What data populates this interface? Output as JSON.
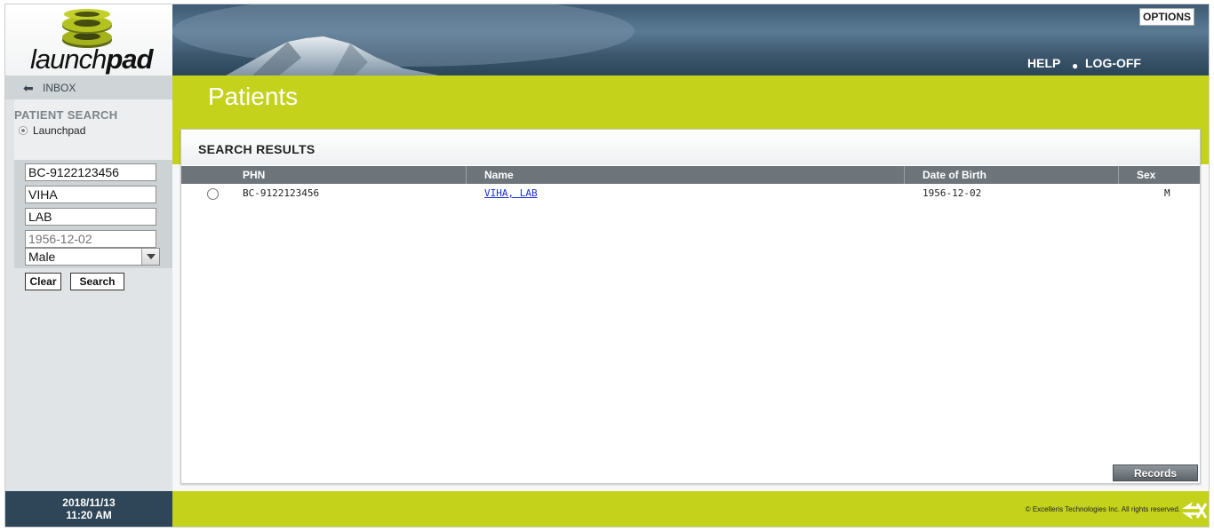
{
  "app": {
    "logo_text_regular": "launch",
    "logo_text_bold": "pad"
  },
  "header": {
    "options_label": "OPTIONS",
    "help_label": "HELP",
    "logoff_label": "LOG-OFF",
    "separator": "●"
  },
  "sidebar": {
    "inbox_label": "INBOX",
    "patient_search_title": "PATIENT SEARCH",
    "source_option": "Launchpad",
    "phn_value": "BC-9122123456",
    "last_name_value": "VIHA",
    "first_name_value": "LAB",
    "dob_placeholder": "1956-12-02",
    "sex_value": "Male",
    "clear_label": "Clear",
    "search_label": "Search"
  },
  "page": {
    "title": "Patients"
  },
  "results": {
    "title": "SEARCH RESULTS",
    "columns": [
      "PHN",
      "Name",
      "Date of Birth",
      "Sex"
    ],
    "rows": [
      {
        "phn": "BC-9122123456",
        "name": "VIHA, LAB",
        "dob": "1956-12-02",
        "sex": "M"
      }
    ],
    "records_label": "Records"
  },
  "footer": {
    "date": "2018/11/13",
    "time": "11:20 AM",
    "copyright": "© Excelleris Technologies Inc. All rights reserved."
  },
  "colors": {
    "accent_green": "#c4d21c",
    "header_blue": "#2f4658",
    "link_blue": "#1a2fd1"
  },
  "icons": {
    "logo": "launchpad-coil-icon",
    "back": "arrow-left-icon",
    "footer_logo": "excelleris-logo-icon"
  }
}
